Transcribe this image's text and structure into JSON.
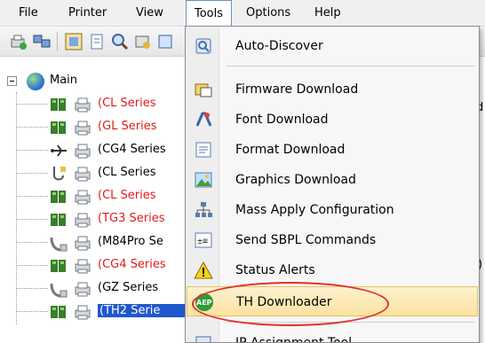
{
  "menubar": {
    "items": [
      {
        "label": "File"
      },
      {
        "label": "Printer"
      },
      {
        "label": "View"
      },
      {
        "label": "Tools"
      },
      {
        "label": "Options"
      },
      {
        "label": "Help"
      }
    ]
  },
  "tree": {
    "root_label": "Main",
    "rows": [
      {
        "label": "(CL Series",
        "color": "red",
        "connection": "network"
      },
      {
        "label": "(GL Series",
        "color": "red",
        "connection": "network"
      },
      {
        "label": "(CG4 Series",
        "color": "black",
        "connection": "usb"
      },
      {
        "label": "(CL Series",
        "color": "black",
        "connection": "serial"
      },
      {
        "label": "(CL Series",
        "color": "red",
        "connection": "network"
      },
      {
        "label": "(TG3 Series",
        "color": "red",
        "connection": "network"
      },
      {
        "label": "(M84Pro Se",
        "color": "black",
        "connection": "parallel"
      },
      {
        "label": "(CG4 Series",
        "color": "red",
        "connection": "network"
      },
      {
        "label": "(GZ Series",
        "color": "black",
        "connection": "parallel"
      },
      {
        "label": "(TH2 Serie",
        "color": "selected",
        "connection": "network"
      }
    ],
    "stray_right": [
      "d",
      ")"
    ]
  },
  "tools_menu": {
    "items": [
      {
        "label": "Auto-Discover",
        "icon": "auto-discover-icon"
      },
      {
        "label": "Firmware Download",
        "icon": "firmware-icon"
      },
      {
        "label": "Font Download",
        "icon": "font-icon"
      },
      {
        "label": "Format Download",
        "icon": "format-icon"
      },
      {
        "label": "Graphics Download",
        "icon": "graphics-icon"
      },
      {
        "label": "Mass Apply Configuration",
        "icon": "mass-apply-icon"
      },
      {
        "label": "Send SBPL Commands",
        "icon": "sbpl-icon"
      },
      {
        "label": "Status Alerts",
        "icon": "warning-icon"
      },
      {
        "label": "TH Downloader",
        "icon": "aep-icon"
      },
      {
        "label": "IP Assignment Tool",
        "icon": "ip-icon"
      }
    ],
    "highlighted_index": 8
  },
  "colors": {
    "red_label": "#e01b1b",
    "selection": "#1f58cc",
    "highlight": "#fbe2a0",
    "annotation": "#e0302a"
  }
}
